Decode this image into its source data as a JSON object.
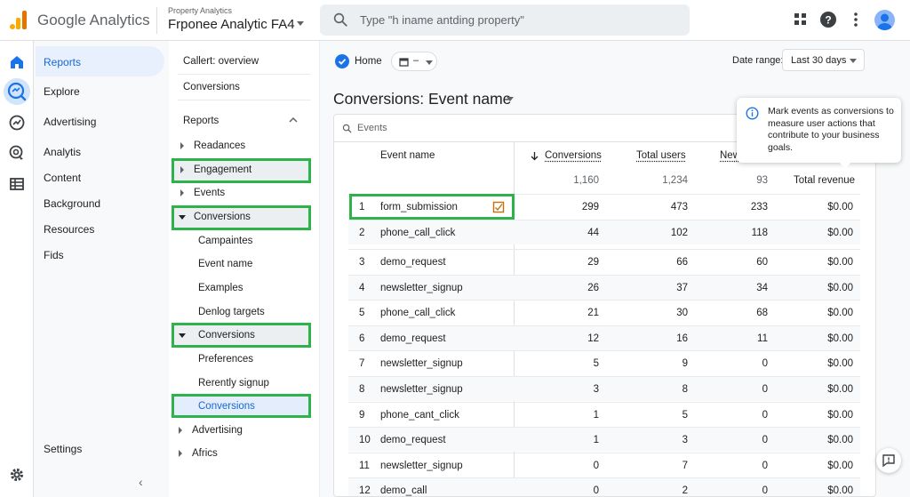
{
  "header": {
    "brand": "Google Analytics",
    "property_label": "Property Analytics",
    "property_name": "Frponee Analytic FA4",
    "search_placeholder": "Type \"h iname antding property\""
  },
  "nav": {
    "items": [
      "Reports",
      "Explore",
      "Advertising",
      "Analytis",
      "Content",
      "Background",
      "Resources",
      "Fids"
    ],
    "settings": "Settings"
  },
  "subnav": {
    "top_items": [
      "Callert: overview",
      "Conversions"
    ],
    "section_title": "Reports",
    "tree": [
      {
        "label": "Readances",
        "expander": "right"
      },
      {
        "label": "Engagement",
        "expander": "right"
      },
      {
        "label": "Events",
        "expander": "right"
      },
      {
        "label": "Conversions",
        "expander": "down"
      },
      {
        "label": "Campaintes",
        "expander": ""
      },
      {
        "label": "Event name",
        "expander": ""
      },
      {
        "label": "Examples",
        "expander": ""
      },
      {
        "label": "Denlog targets",
        "expander": ""
      },
      {
        "label": "Conversions",
        "expander": "down"
      },
      {
        "label": "Preferences",
        "expander": ""
      },
      {
        "label": "Rerently signup",
        "expander": ""
      },
      {
        "label": "Conversions",
        "expander": ""
      },
      {
        "label": "Advertising",
        "expander": "right"
      },
      {
        "label": "Africs",
        "expander": "right"
      }
    ]
  },
  "toolbar": {
    "home_label": "Home",
    "compare_label": "–",
    "date_range_label": "Date range:",
    "date_range_value": "Last 30 days"
  },
  "page_title": "Conversions: Event name",
  "table": {
    "search_label": "Events",
    "headers": {
      "event_name": "Event name",
      "conversions": "Conversions",
      "total_users": "Total users",
      "new_users": "New",
      "total_revenue": "Total revenue"
    },
    "totals": {
      "conversions": "1,160",
      "total_users": "1,234",
      "new_users": "93"
    },
    "rows": [
      {
        "idx": "1",
        "name": "form_submission",
        "conv": "299",
        "users": "473",
        "new": "233",
        "rev": "$0.00"
      },
      {
        "idx": "2",
        "name": "phone_call_click",
        "conv": "44",
        "users": "102",
        "new": "118",
        "rev": "$0.00"
      },
      {
        "idx": "3",
        "name": "demo_request",
        "conv": "29",
        "users": "66",
        "new": "60",
        "rev": "$0.00"
      },
      {
        "idx": "4",
        "name": "newsletter_signup",
        "conv": "26",
        "users": "37",
        "new": "34",
        "rev": "$0.00"
      },
      {
        "idx": "5",
        "name": "phone_call_click",
        "conv": "21",
        "users": "30",
        "new": "68",
        "rev": "$0.00"
      },
      {
        "idx": "6",
        "name": "demo_request",
        "conv": "12",
        "users": "16",
        "new": "11",
        "rev": "$0.00"
      },
      {
        "idx": "7",
        "name": "newsletter_signup",
        "conv": "5",
        "users": "9",
        "new": "0",
        "rev": "$0.00"
      },
      {
        "idx": "8",
        "name": "newsletter_signup",
        "conv": "3",
        "users": "8",
        "new": "0",
        "rev": "$0.00"
      },
      {
        "idx": "9",
        "name": "phone_cant_click",
        "conv": "1",
        "users": "5",
        "new": "0",
        "rev": "$0.00"
      },
      {
        "idx": "10",
        "name": "demo_request",
        "conv": "1",
        "users": "3",
        "new": "0",
        "rev": "$0.00"
      },
      {
        "idx": "11",
        "name": "newsletter_signup",
        "conv": "0",
        "users": "7",
        "new": "0",
        "rev": "$0.00"
      },
      {
        "idx": "12",
        "name": "demo_call",
        "conv": "0",
        "users": "2",
        "new": "0",
        "rev": "$0.00"
      }
    ]
  },
  "tooltip": {
    "text": "Mark events as conversions to measure user actions that contribute to your business goals."
  },
  "colors": {
    "accent": "#1a73e8",
    "highlight": "#2db34a",
    "nav_active": "#e8f0fe"
  },
  "icons": [
    "analytics-logo-icon",
    "search-icon",
    "apps-icon",
    "help-icon",
    "more-vert-icon",
    "home-icon",
    "reports-icon",
    "explore-icon",
    "advertising-icon",
    "table-icon",
    "settings-icon",
    "info-icon",
    "mark-conversion-icon",
    "feedback-icon"
  ]
}
